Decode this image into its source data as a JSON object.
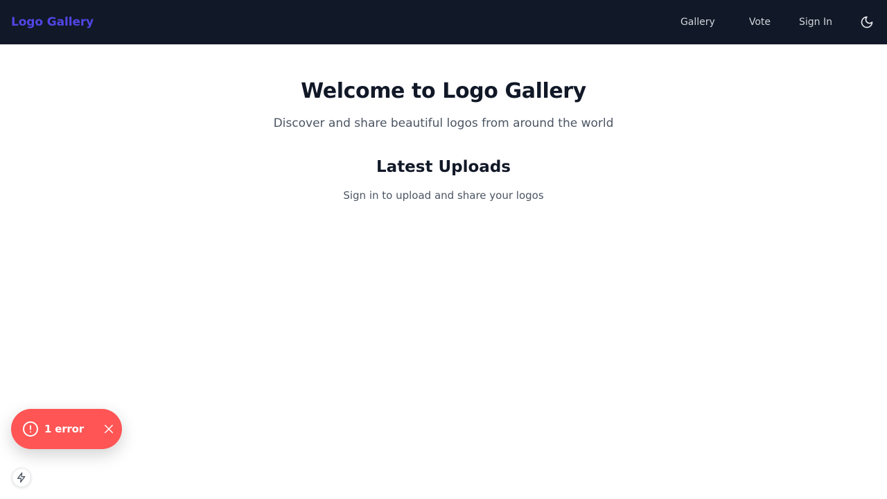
{
  "header": {
    "brand": "Logo Gallery",
    "nav": {
      "gallery": "Gallery",
      "vote": "Vote",
      "sign_in": "Sign In"
    },
    "theme_toggle_icon": "moon-icon"
  },
  "main": {
    "title": "Welcome to Logo Gallery",
    "subtitle": "Discover and share beautiful logos from around the world",
    "section_title": "Latest Uploads",
    "section_note": "Sign in to upload and share your logos"
  },
  "error_toast": {
    "label": "1 error",
    "icon": "alert-circle-icon",
    "close_icon": "close-icon",
    "color": "#ff5555"
  },
  "devtools": {
    "icon": "lightning-icon"
  },
  "colors": {
    "header_bg": "#111827",
    "brand": "#5046e5",
    "nav_text": "#d1d5db",
    "heading": "#111827",
    "muted": "#4b5563"
  }
}
